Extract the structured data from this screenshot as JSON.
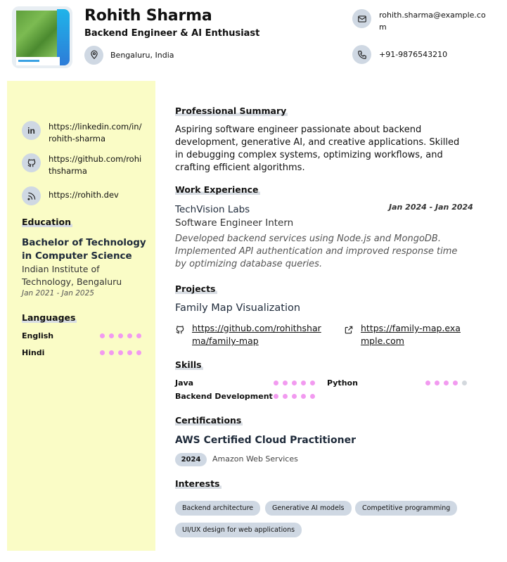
{
  "header": {
    "name": "Rohith Sharma",
    "role": "Backend Engineer & AI Enthusiast",
    "location": "Bengaluru, India",
    "email": "rohith.sharma@example.com",
    "phone": "+91-9876543210"
  },
  "sidebar": {
    "links": [
      {
        "icon": "linkedin-icon",
        "text": "https://linkedin.com/in/rohith-sharma"
      },
      {
        "icon": "github-icon",
        "text": "https://github.com/rohithsharma"
      },
      {
        "icon": "rss-icon",
        "text": "https://rohith.dev"
      }
    ],
    "education_title": "Education",
    "education": {
      "degree": "Bachelor of Technology in Computer Science",
      "institution": "Indian Institute of Technology, Bengaluru",
      "dates": "Jan 2021 - Jan 2025"
    },
    "languages_title": "Languages",
    "languages": [
      {
        "name": "English",
        "level": 5,
        "max": 5
      },
      {
        "name": "Hindi",
        "level": 5,
        "max": 5
      }
    ]
  },
  "main": {
    "summary_title": "Professional Summary",
    "summary": "Aspiring software engineer passionate about backend development, generative AI, and creative applications. Skilled in debugging complex systems, optimizing workflows, and crafting efficient algorithms.",
    "experience_title": "Work Experience",
    "experience": {
      "company": "TechVision Labs",
      "dates": "Jan 2024 - Jan 2024",
      "title": "Software Engineer Intern",
      "description": "Developed backend services using Node.js and MongoDB. Implemented API authentication and improved response time by optimizing database queries."
    },
    "projects_title": "Projects",
    "project": {
      "name": "Family Map Visualization",
      "repo": "https://github.com/rohithsharma/family-map",
      "url": "https://family-map.example.com"
    },
    "skills_title": "Skills",
    "skills": [
      {
        "name": "Java",
        "level": 5,
        "max": 5
      },
      {
        "name": "Python",
        "level": 4,
        "max": 5
      },
      {
        "name": "Backend Development",
        "level": 5,
        "max": 5
      }
    ],
    "certifications_title": "Certifications",
    "certification": {
      "name": "AWS Certified Cloud Practitioner",
      "year": "2024",
      "issuer": "Amazon Web Services"
    },
    "interests_title": "Interests",
    "interests": [
      "Backend architecture",
      "Generative AI models",
      "Competitive programming",
      "UI/UX design for web applications"
    ]
  },
  "colors": {
    "sidebar_bg": "#fafcc6",
    "dot_on": "#f29af0",
    "dot_off": "#d3d8dd",
    "chip_bg": "#cfd8e3"
  }
}
